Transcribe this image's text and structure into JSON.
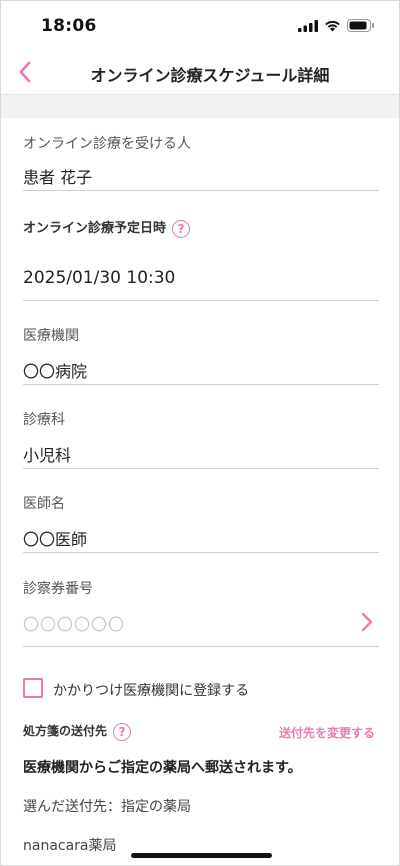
{
  "status_bar": {
    "time": "18:06"
  },
  "nav": {
    "title": "オンライン診療スケジュール詳細"
  },
  "patient": {
    "label": "オンライン診療を受ける人",
    "value": "患者 花子"
  },
  "schedule": {
    "label": "オンライン診療予定日時",
    "help": "?",
    "value": "2025/01/30  10:30"
  },
  "institution": {
    "label": "医療機関",
    "value": "〇〇病院"
  },
  "department": {
    "label": "診療科",
    "value": "小児科"
  },
  "doctor": {
    "label": "医師名",
    "value": "〇〇医師"
  },
  "ticket": {
    "label": "診察券番号",
    "placeholder": "〇〇〇〇〇〇"
  },
  "family_clinic": {
    "label": "かかりつけ医療機関に登録する",
    "checked": false
  },
  "prescription": {
    "label": "処方箋の送付先",
    "help": "?",
    "change_link": "送付先を変更する",
    "notice": "医療機関からご指定の薬局へ郵送されます。",
    "selected_destination": "選んだ送付先：指定の薬局",
    "pharmacy_name": "nanacara薬局"
  },
  "colors": {
    "accent": "#e87bb3",
    "divider": "#cfcfcf",
    "section_bg": "#f2f2f2"
  },
  "icons": [
    "back-chevron-icon",
    "help-circle-icon",
    "chevron-right-icon",
    "signal-icon",
    "wifi-icon",
    "battery-icon"
  ]
}
